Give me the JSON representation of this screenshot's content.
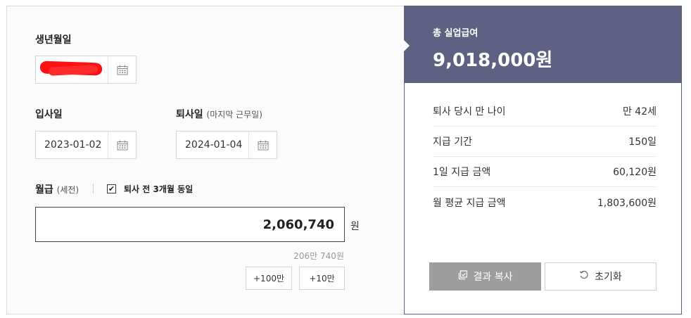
{
  "form": {
    "birth_label": "생년월일",
    "join_label": "입사일",
    "join_value": "2023-01-02",
    "leave_label": "퇴사일",
    "leave_sub": "(마지막 근무일)",
    "leave_value": "2024-01-04",
    "salary_label": "월급",
    "salary_sub": "(세전)",
    "same_3months_label": "퇴사 전 3개월 동일",
    "same_3months_checked": true,
    "salary_value": "2,060,740",
    "salary_unit": "원",
    "salary_hint": "206만 740원",
    "add_1m_label": "+100만",
    "add_100k_label": "+10만",
    "icons": {
      "calendar": "calendar-icon",
      "check": "check-icon"
    }
  },
  "result": {
    "total_label": "총 실업급여",
    "total_value": "9,018,000원",
    "rows": [
      {
        "label": "퇴사 당시 만 나이",
        "value": "만 42세"
      },
      {
        "label": "지급 기간",
        "value": "150일"
      },
      {
        "label": "1일 지급 금액",
        "value": "60,120원"
      },
      {
        "label": "월 평균 지급 금액",
        "value": "1,803,600원"
      }
    ],
    "copy_label": "결과 복사",
    "reset_label": "초기화",
    "icons": {
      "copy": "copy-icon",
      "reset": "refresh-icon"
    }
  },
  "colors": {
    "accent": "#5e6181",
    "copy_button": "#9d9d9d",
    "redaction": "#ff1111"
  }
}
